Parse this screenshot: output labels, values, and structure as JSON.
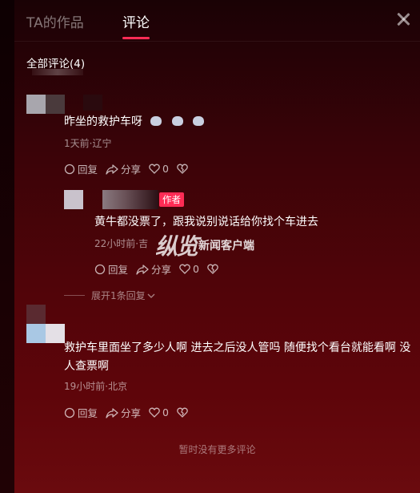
{
  "tabs": [
    {
      "label": "TA的作品"
    },
    {
      "label": "评论"
    }
  ],
  "comment_count_label": "全部评论(4)",
  "comments": [
    {
      "text": "昨坐的救护车呀",
      "emojis": [
        "cat-emoji",
        "cat-emoji",
        "cat-emoji"
      ],
      "meta": "1天前·辽宁",
      "reply_label": "回复",
      "share_label": "分享",
      "likes": "0"
    },
    {
      "badge": "作者",
      "text": "黄牛都没票了，跟我说别说话给你找个车进去",
      "meta": "22小时前·吉",
      "reply_label": "回复",
      "share_label": "分享",
      "likes": "0"
    },
    {
      "text": "救护车里面坐了多少人啊 进去之后没人管吗 随便找个看台就能看啊 没人查票啊",
      "meta": "19小时前·北京",
      "reply_label": "回复",
      "share_label": "分享",
      "likes": "0"
    }
  ],
  "expand_label": "展开1条回复",
  "footer_text": "暂时没有更多评论",
  "watermark": {
    "brush": "纵览",
    "text": "新闻客户端"
  },
  "colors": {
    "accent": "#fe2c55"
  }
}
